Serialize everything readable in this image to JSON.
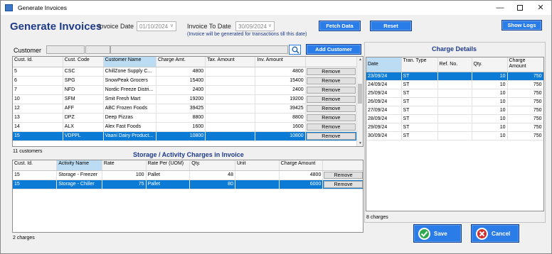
{
  "window": {
    "title": "Generate Invoices",
    "min": "—",
    "close": "✕"
  },
  "heading": "Generate Invoices",
  "invoice_date": {
    "label": "Invoice Date",
    "value": "01/10/2024"
  },
  "invoice_to_date": {
    "label": "Invoice To Date",
    "value": "30/09/2024"
  },
  "note": "(Invoice will be generated for transactions till this date)",
  "buttons": {
    "fetch": "Fetch Data",
    "reset": "Reset",
    "show_logs": "Show Logs",
    "add_customer": "Add Customer",
    "save": "Save",
    "cancel": "Cancel"
  },
  "customer_label": "Customer",
  "customers": {
    "columns": [
      "Cust. Id.",
      "Cust. Code",
      "Customer Name",
      "Charge Amt.",
      "Tax. Amount",
      "Inv. Amount",
      ""
    ],
    "rows": [
      {
        "id": "5",
        "code": "CSC",
        "name": "ChillZone Supply C...",
        "charge": "4800",
        "tax": "",
        "inv": "4800",
        "action": "Remove",
        "selected": false
      },
      {
        "id": "6",
        "code": "SPG",
        "name": "SnowPeak Grocers",
        "charge": "15400",
        "tax": "",
        "inv": "15400",
        "action": "Remove",
        "selected": false
      },
      {
        "id": "7",
        "code": "NFD",
        "name": "Nordic Freeze Distri...",
        "charge": "2400",
        "tax": "",
        "inv": "2400",
        "action": "Remove",
        "selected": false
      },
      {
        "id": "10",
        "code": "SFM",
        "name": "Smit Fresh Mart",
        "charge": "19200",
        "tax": "",
        "inv": "19200",
        "action": "Remove",
        "selected": false
      },
      {
        "id": "12",
        "code": "AFF",
        "name": "ABC Frozen Foods",
        "charge": "39425",
        "tax": "",
        "inv": "39425",
        "action": "Remove",
        "selected": false
      },
      {
        "id": "13",
        "code": "DPZ",
        "name": "Deep Pizzas",
        "charge": "8800",
        "tax": "",
        "inv": "8800",
        "action": "Remove",
        "selected": false
      },
      {
        "id": "14",
        "code": "ALX",
        "name": "Alex Fast Foods",
        "charge": "1600",
        "tax": "",
        "inv": "1600",
        "action": "Remove",
        "selected": false
      },
      {
        "id": "15",
        "code": "VDPPL",
        "name": "Vaani Dairy Product...",
        "charge": "10800",
        "tax": "",
        "inv": "10800",
        "action": "Remove",
        "selected": true
      }
    ],
    "count": "11 customers"
  },
  "storage": {
    "title": "Storage / Activity Charges in Invoice",
    "columns": [
      "Cust. Id.",
      "Activity Name",
      "Rate",
      "Rate Per (UOM)",
      "Qty.",
      "Unit",
      "Charge Amount",
      ""
    ],
    "rows": [
      {
        "id": "15",
        "activity": "Storage - Freezer",
        "rate": "100",
        "uom": "Pallet",
        "qty": "48",
        "unit": "",
        "amount": "4800",
        "action": "Remove",
        "selected": false
      },
      {
        "id": "15",
        "activity": "Storage - Chiller",
        "rate": "75",
        "uom": "Pallet",
        "qty": "80",
        "unit": "",
        "amount": "6000",
        "action": "Remove",
        "selected": true
      }
    ],
    "count": "2 charges"
  },
  "charge_details": {
    "title": "Charge Details",
    "columns": [
      "Date",
      "Tran. Type",
      "Ref. No.",
      "Qty.",
      "Charge Amount"
    ],
    "rows": [
      {
        "date": "23/09/24",
        "type": "ST",
        "ref": "",
        "qty": "10",
        "amount": "750",
        "selected": true
      },
      {
        "date": "24/09/24",
        "type": "ST",
        "ref": "",
        "qty": "10",
        "amount": "750",
        "selected": false
      },
      {
        "date": "25/09/24",
        "type": "ST",
        "ref": "",
        "qty": "10",
        "amount": "750",
        "selected": false
      },
      {
        "date": "26/09/24",
        "type": "ST",
        "ref": "",
        "qty": "10",
        "amount": "750",
        "selected": false
      },
      {
        "date": "27/09/24",
        "type": "ST",
        "ref": "",
        "qty": "10",
        "amount": "750",
        "selected": false
      },
      {
        "date": "28/09/24",
        "type": "ST",
        "ref": "",
        "qty": "10",
        "amount": "750",
        "selected": false
      },
      {
        "date": "29/09/24",
        "type": "ST",
        "ref": "",
        "qty": "10",
        "amount": "750",
        "selected": false
      },
      {
        "date": "30/09/24",
        "type": "ST",
        "ref": "",
        "qty": "10",
        "amount": "750",
        "selected": false
      }
    ],
    "count": "8 charges"
  },
  "colors": {
    "accent": "#2a7ce8",
    "heading": "#1e3a8a",
    "selected_row": "#0b7bd6",
    "save_icon": "#2fa84f",
    "cancel_icon": "#d32f2f"
  }
}
